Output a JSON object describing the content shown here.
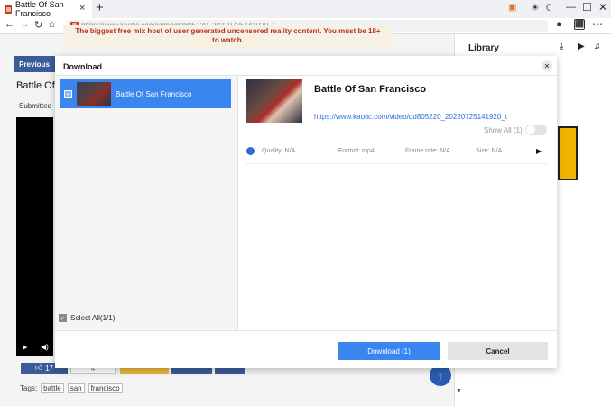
{
  "browser": {
    "tab_title": "Battle Of San Francisco",
    "url": "https://www.kaotic.com/video/dd805220_20220725141920_t"
  },
  "page": {
    "warning_line1": "The biggest free mix host of user generated uncensored reality content. You must be 18+",
    "warning_line2": "to watch.",
    "previous_label": "Previous",
    "video_title_partial": "Battle Of",
    "submitted_label": "Submitted",
    "like_count": "17",
    "dislike_count": "4",
    "tags_label": "Tags:",
    "tags": [
      "battle",
      "san",
      "francisco"
    ]
  },
  "library": {
    "title": "Library"
  },
  "modal": {
    "title": "Download",
    "item_name": "Battle Of San Francisco",
    "select_all_label": "Select All(1/1)",
    "detail_title": "Battle Of San Francisco",
    "detail_url": "https://www.kaotic.com/video/dd805220_20220725141920_t",
    "show_all_label": "Show All",
    "show_all_count": "(1)",
    "quality": "Quality: N/A",
    "format": "Format: mp4",
    "frame_rate": "Frame rate: N/A",
    "size": "Size: N/A",
    "download_label": "Download (1)",
    "cancel_label": "Cancel"
  },
  "colors": {
    "accent": "#3a86f0",
    "brand_dark": "#3b5b99",
    "warning_text": "#b3312a"
  }
}
